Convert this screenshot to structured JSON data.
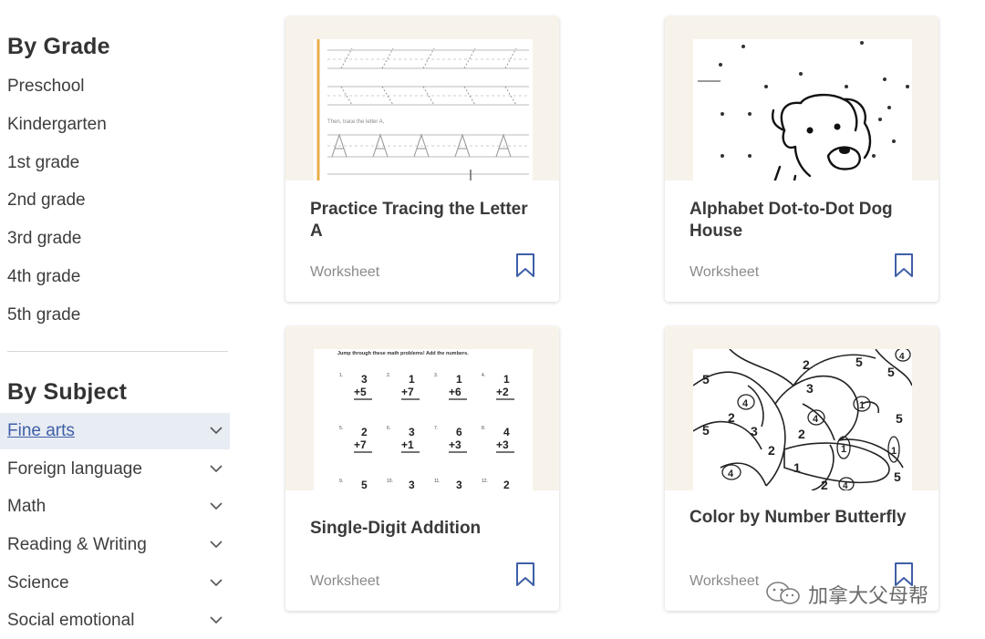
{
  "sidebar": {
    "by_grade_title": "By Grade",
    "grades": [
      "Preschool",
      "Kindergarten",
      "1st grade",
      "2nd grade",
      "3rd grade",
      "4th grade",
      "5th grade"
    ],
    "by_subject_title": "By Subject",
    "subjects": [
      {
        "label": "Fine arts",
        "active": true
      },
      {
        "label": "Foreign language",
        "active": false
      },
      {
        "label": "Math",
        "active": false
      },
      {
        "label": "Reading & Writing",
        "active": false
      },
      {
        "label": "Science",
        "active": false
      },
      {
        "label": "Social emotional",
        "active": false
      }
    ]
  },
  "cards": [
    {
      "title": "Practice Tracing the Letter A",
      "type": "Worksheet",
      "thumb_caption": "Then, trace the letter A."
    },
    {
      "title": "Alphabet Dot-to-Dot Dog House",
      "type": "Worksheet"
    },
    {
      "title": "Single-Digit Addition",
      "type": "Worksheet",
      "thumb_caption": "Jump through these math problems! Add the numbers."
    },
    {
      "title": "Color by Number Butterfly",
      "type": "Worksheet"
    }
  ],
  "colors": {
    "accent": "#3f5fa7",
    "thumb_bg": "#f7f3ea",
    "active_bg": "#e8ecf3"
  },
  "watermark": {
    "text": "加拿大父母帮"
  }
}
